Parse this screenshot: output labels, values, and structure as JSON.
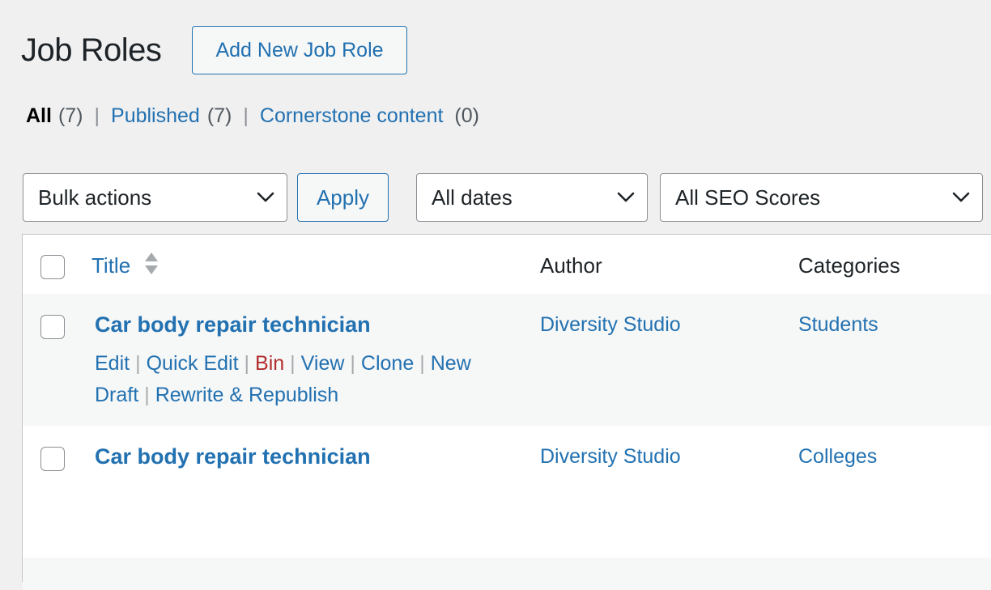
{
  "header": {
    "title": "Job Roles",
    "add_new_label": "Add New Job Role"
  },
  "views": [
    {
      "label": "All",
      "count": "(7)",
      "current": true
    },
    {
      "label": "Published",
      "count": "(7)",
      "current": false
    },
    {
      "label": "Cornerstone content",
      "count": "(0)",
      "current": false
    }
  ],
  "filters": {
    "bulk_actions": "Bulk actions",
    "apply_label": "Apply",
    "dates": "All dates",
    "seo_scores": "All SEO Scores"
  },
  "table": {
    "columns": {
      "title": "Title",
      "author": "Author",
      "categories": "Categories"
    },
    "rows": [
      {
        "title": "Car body repair technician",
        "author": "Diversity Studio",
        "category": "Students",
        "actions": [
          "Edit",
          "Quick Edit",
          "Bin",
          "View",
          "Clone",
          "New Draft",
          "Rewrite & Republish"
        ]
      },
      {
        "title": "Car body repair technician",
        "author": "Diversity Studio",
        "category": "Colleges"
      }
    ]
  },
  "colors": {
    "link": "#2271b1",
    "trash": "#b32d2e",
    "background": "#f0f0f1"
  }
}
